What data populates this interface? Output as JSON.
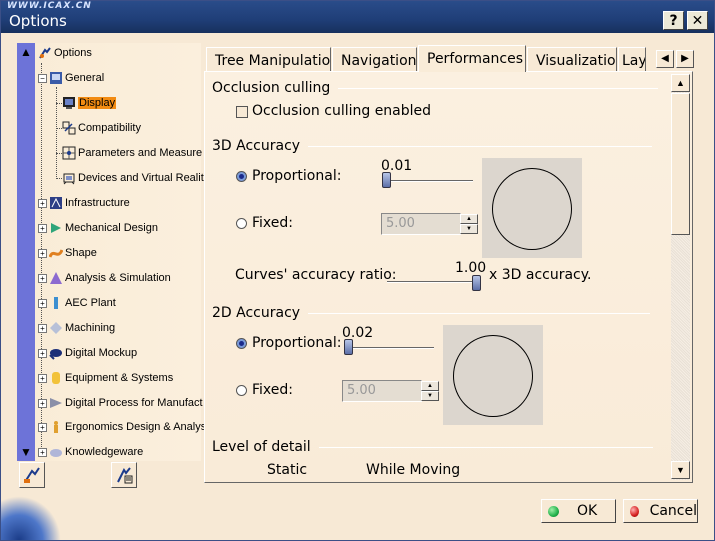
{
  "window": {
    "watermark": "WWW.ICAX.CN",
    "title": "Options",
    "help_label": "?",
    "close_label": "✕"
  },
  "tree": {
    "items": [
      {
        "label": "Options",
        "icon": "options-icon"
      },
      {
        "label": "General",
        "icon": "general-icon"
      },
      {
        "label": "Display",
        "icon": "display-icon"
      },
      {
        "label": "Compatibility",
        "icon": "compatibility-icon"
      },
      {
        "label": "Parameters and Measure",
        "icon": "parameters-icon"
      },
      {
        "label": "Devices and Virtual Realit",
        "icon": "devices-icon"
      },
      {
        "label": "Infrastructure",
        "icon": "infrastructure-icon"
      },
      {
        "label": "Mechanical Design",
        "icon": "mechanical-design-icon"
      },
      {
        "label": "Shape",
        "icon": "shape-icon"
      },
      {
        "label": "Analysis & Simulation",
        "icon": "analysis-icon"
      },
      {
        "label": "AEC Plant",
        "icon": "aec-plant-icon"
      },
      {
        "label": "Machining",
        "icon": "machining-icon"
      },
      {
        "label": "Digital Mockup",
        "icon": "digital-mockup-icon"
      },
      {
        "label": "Equipment & Systems",
        "icon": "equipment-icon"
      },
      {
        "label": "Digital Process for Manufact",
        "icon": "digital-process-icon"
      },
      {
        "label": "Ergonomics Design & Analys",
        "icon": "ergonomics-icon"
      },
      {
        "label": "Knowledgeware",
        "icon": "knowledgeware-icon"
      }
    ],
    "selected": "Display"
  },
  "tabs": [
    {
      "label": "Tree Manipulation"
    },
    {
      "label": "Navigation"
    },
    {
      "label": "Performances"
    },
    {
      "label": "Visualization"
    },
    {
      "label": "Lay"
    }
  ],
  "active_tab": "Performances",
  "performances": {
    "occlusion": {
      "section": "Occlusion culling",
      "checkbox_label": "Occlusion culling enabled",
      "checked": false
    },
    "accuracy_3d": {
      "section": "3D Accuracy",
      "proportional_label": "Proportional:",
      "proportional_value": "0.01",
      "proportional_selected": true,
      "fixed_label": "Fixed:",
      "fixed_value": "5.00",
      "curves_label": "Curves' accuracy ratio:",
      "curves_value": "1.00",
      "curves_suffix": "x 3D accuracy."
    },
    "accuracy_2d": {
      "section": "2D Accuracy",
      "proportional_label": "Proportional:",
      "proportional_value": "0.02",
      "proportional_selected": true,
      "fixed_label": "Fixed:",
      "fixed_value": "5.00"
    },
    "level_of_detail": {
      "section": "Level of detail",
      "static_label": "Static",
      "moving_label": "While Moving"
    }
  },
  "buttons": {
    "ok": "OK",
    "cancel": "Cancel"
  },
  "colors": {
    "titlebar": "#1f3e77",
    "selection": "#f28b12",
    "ok_dot": "#22b24c",
    "cancel_dot": "#d62020"
  }
}
